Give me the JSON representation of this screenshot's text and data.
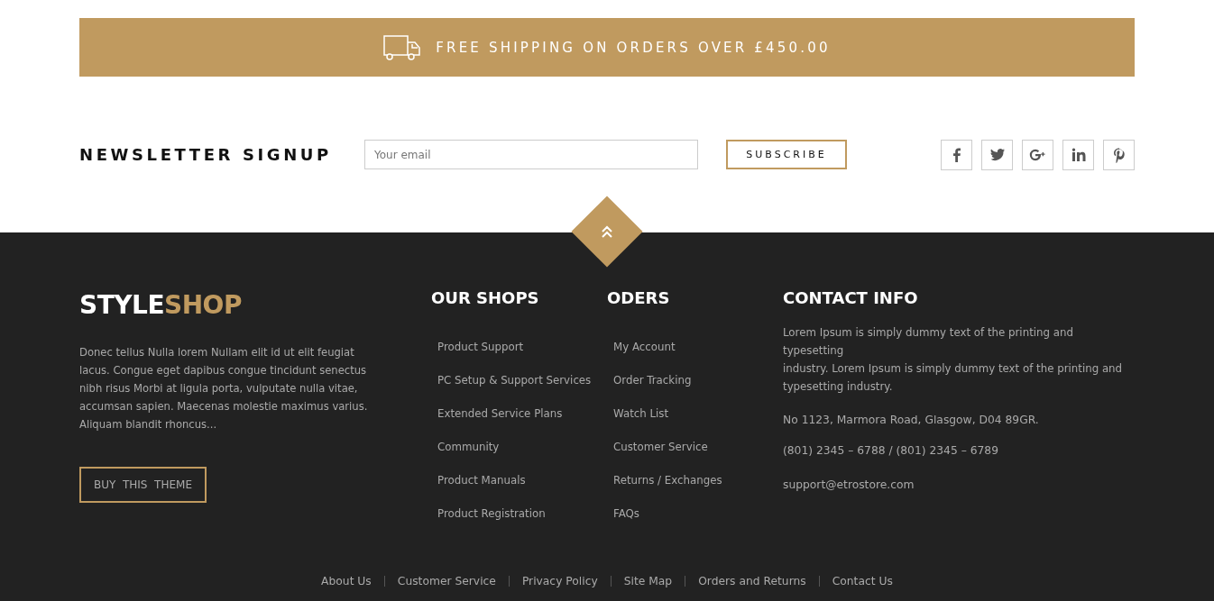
{
  "shipping_banner": {
    "text": "FREE SHIPPING ON ORDERS OVER £450.00"
  },
  "newsletter": {
    "title": "NEWSLETTER SIGNUP",
    "email_placeholder": "Your email",
    "button": "SUBSCRIBE"
  },
  "social": [
    {
      "kind": "facebook"
    },
    {
      "kind": "twitter"
    },
    {
      "kind": "google-plus"
    },
    {
      "kind": "linkedin"
    },
    {
      "kind": "pinterest"
    }
  ],
  "footer": {
    "logo": [
      "STYLE",
      "SHOP"
    ],
    "about": "Donec tellus Nulla lorem Nullam elit id ut elit feugiat lacus. Congue eget dapibus congue tincidunt senectus nibh risus Morbi at ligula porta, vulputate nulla vitae, accumsan sapien. Maecenas molestie maximus varius. Aliquam blandit rhoncus...",
    "buy_button": "BUY  THIS  THEME",
    "columns": [
      {
        "title": "OUR SHOPS",
        "links": [
          "Product Support",
          "PC Setup & Support Services",
          "Extended Service Plans",
          "Community",
          "Product Manuals",
          "Product Registration"
        ]
      },
      {
        "title": "ODERS",
        "links": [
          "My Account",
          "Order Tracking",
          "Watch List",
          "Customer Service",
          "Returns / Exchanges",
          "FAQs"
        ]
      }
    ],
    "contact": {
      "title": "CONTACT INFO",
      "lines": [
        "Lorem Ipsum is simply dummy text of the printing and typesetting",
        "industry. Lorem Ipsum is simply dummy text of the printing and typesetting industry."
      ],
      "address": "No 1123, Marmora Road, Glasgow, D04 89GR.",
      "phone": "(801) 2345 – 6788 / (801) 2345 – 6789",
      "email": "support@etrostore.com"
    },
    "bottom_links": [
      "About Us",
      "Customer Service",
      "Privacy Policy",
      "Site Map",
      "Orders and Returns",
      "Contact Us"
    ]
  }
}
